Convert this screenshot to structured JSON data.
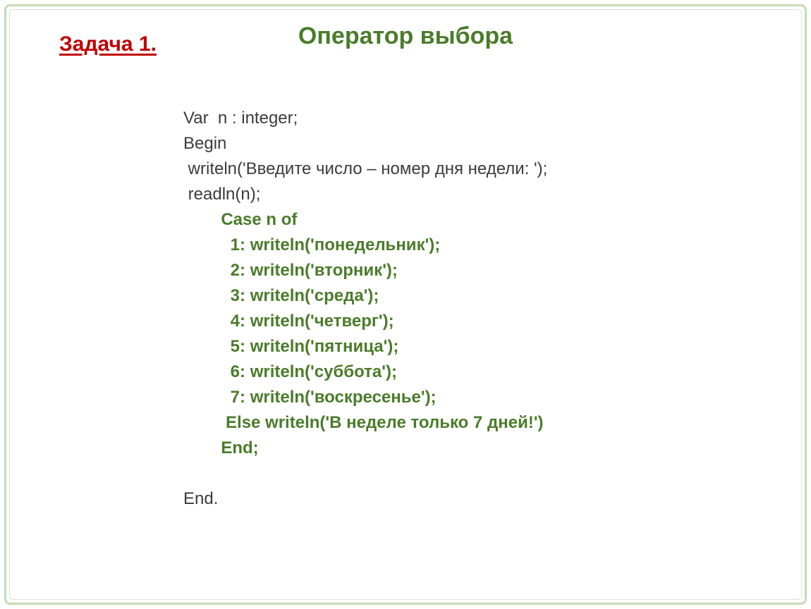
{
  "task_label": "Задача 1.",
  "title": "Оператор выбора",
  "code": {
    "var_line": "Var  n : integer;",
    "begin_line": "Begin",
    "writeln_prompt": " writeln('Введите число – номер дня недели: ');",
    "readln_line": " readln(n);",
    "case_line": "        Case n of",
    "c1": "          1: writeln('понедельник');",
    "c2": "          2: writeln('вторник');",
    "c3": "          3: writeln('среда');",
    "c4": "          4: writeln('четверг');",
    "c5": "          5: writeln('пятница');",
    "c6": "          6: writeln('суббота');",
    "c7": "          7: writeln('воскресенье');",
    "else_line": "         Else writeln('В неделе только 7 дней!')",
    "end_case": "        End;",
    "end_prog": "End."
  }
}
